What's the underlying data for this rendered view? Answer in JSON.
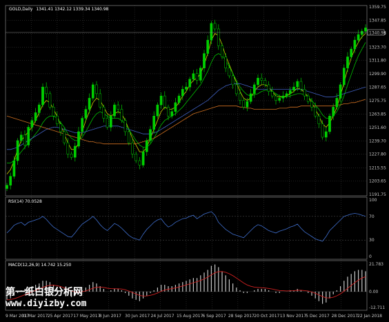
{
  "header": {
    "symbol_label": "GOLD,Daily",
    "ohlc": "1341.41 1342.12 1339.34 1340.98",
    "rsi_label": "RSI(14) 70.0528",
    "macd_label": "MACD(12,26,9) 14.742 15.250"
  },
  "current_price_label": "1340.98",
  "colors": {
    "background": "#000000",
    "candle_up": "#00d000",
    "candle_down": "#000000",
    "candle_outline": "#00d000",
    "ma_short": "#d0d000",
    "ma_mid": "#00c000",
    "ma_long_blue": "#4060c0",
    "ma_long_orange": "#d07020",
    "rsi_line": "#4070d0",
    "macd_hist": "#c8c8c8",
    "macd_signal": "#d02020",
    "grid": "#555555"
  },
  "watermark": {
    "line1": "第一纸白银分析网",
    "line2": "www.diyizby.com"
  },
  "chart_data": [
    {
      "type": "candlestick",
      "title": "GOLD,Daily",
      "price_axis_ticks": [
        "1359.75",
        "1347.85",
        "1335.95",
        "1323.70",
        "1311.80",
        "1299.90",
        "1287.65",
        "1275.75",
        "1263.85",
        "1251.60",
        "1239.70",
        "1227.80",
        "1215.55",
        "1203.65",
        "1191.75"
      ],
      "ylim": [
        1191.75,
        1359.75
      ],
      "date_ticks": [
        "9 Mar 2017",
        "31 Mar 2017",
        "25 Apr 2017",
        "17 May 2017",
        "8 Jun 2017",
        "30 Jun 2017",
        "24 Jul 2017",
        "15 Aug 2017",
        "6 Sep 2017",
        "28 Sep 2017",
        "20 Oct 2017",
        "13 Nov 2017",
        "5 Dec 2017",
        "28 Dec 2017",
        "22 Jan 2018"
      ],
      "close_path": [
        1200,
        1208,
        1222,
        1240,
        1245,
        1236,
        1252,
        1258,
        1265,
        1272,
        1288,
        1282,
        1270,
        1262,
        1255,
        1248,
        1238,
        1228,
        1225,
        1235,
        1248,
        1260,
        1268,
        1278,
        1290,
        1282,
        1270,
        1260,
        1252,
        1262,
        1272,
        1268,
        1258,
        1248,
        1238,
        1228,
        1222,
        1218,
        1230,
        1240,
        1250,
        1262,
        1272,
        1280,
        1270,
        1262,
        1266,
        1274,
        1280,
        1286,
        1288,
        1295,
        1300,
        1294,
        1305,
        1318,
        1330,
        1345,
        1340,
        1325,
        1315,
        1305,
        1298,
        1290,
        1282,
        1276,
        1270,
        1275,
        1282,
        1290,
        1296,
        1294,
        1290,
        1284,
        1280,
        1276,
        1278,
        1280,
        1282,
        1285,
        1288,
        1293,
        1286,
        1280,
        1275,
        1270,
        1262,
        1255,
        1243,
        1248,
        1262,
        1270,
        1278,
        1290,
        1305,
        1315,
        1322,
        1330,
        1335,
        1338,
        1340.98
      ],
      "series": [
        {
          "name": "MA short",
          "values": [
            1210,
            1214,
            1222,
            1232,
            1240,
            1244,
            1248,
            1252,
            1258,
            1265,
            1272,
            1276,
            1274,
            1268,
            1262,
            1254,
            1246,
            1238,
            1232,
            1232,
            1238,
            1248,
            1258,
            1266,
            1274,
            1278,
            1276,
            1270,
            1264,
            1262,
            1264,
            1266,
            1264,
            1258,
            1250,
            1242,
            1236,
            1230,
            1230,
            1234,
            1242,
            1250,
            1258,
            1266,
            1270,
            1268,
            1268,
            1270,
            1274,
            1280,
            1284,
            1290,
            1294,
            1296,
            1300,
            1308,
            1318,
            1330,
            1336,
            1334,
            1326,
            1316,
            1308,
            1300,
            1292,
            1284,
            1278,
            1276,
            1278,
            1284,
            1288,
            1290,
            1290,
            1288,
            1284,
            1280,
            1279,
            1279,
            1280,
            1282,
            1284,
            1287,
            1286,
            1283,
            1279,
            1274,
            1268,
            1262,
            1255,
            1252,
            1256,
            1262,
            1270,
            1280,
            1292,
            1304,
            1314,
            1322,
            1328,
            1333,
            1336
          ]
        },
        {
          "name": "MA mid",
          "values": [
            1220,
            1220,
            1222,
            1226,
            1230,
            1234,
            1238,
            1242,
            1246,
            1250,
            1256,
            1260,
            1262,
            1262,
            1260,
            1256,
            1252,
            1246,
            1242,
            1240,
            1240,
            1243,
            1248,
            1254,
            1260,
            1264,
            1266,
            1264,
            1262,
            1260,
            1260,
            1260,
            1258,
            1255,
            1250,
            1245,
            1240,
            1236,
            1234,
            1234,
            1237,
            1242,
            1248,
            1254,
            1258,
            1260,
            1262,
            1264,
            1267,
            1270,
            1274,
            1278,
            1282,
            1286,
            1290,
            1296,
            1302,
            1310,
            1316,
            1318,
            1316,
            1312,
            1306,
            1300,
            1294,
            1288,
            1284,
            1281,
            1280,
            1281,
            1282,
            1284,
            1285,
            1285,
            1284,
            1282,
            1280,
            1279,
            1279,
            1280,
            1281,
            1282,
            1282,
            1281,
            1279,
            1276,
            1272,
            1268,
            1263,
            1260,
            1260,
            1262,
            1266,
            1272,
            1280,
            1290,
            1299,
            1308,
            1316,
            1322,
            1328
          ]
        },
        {
          "name": "MA long blue",
          "values": [
            1232,
            1232,
            1233,
            1234,
            1236,
            1238,
            1240,
            1242,
            1244,
            1246,
            1248,
            1250,
            1251,
            1252,
            1252,
            1251,
            1250,
            1249,
            1248,
            1247,
            1247,
            1247,
            1248,
            1249,
            1250,
            1251,
            1252,
            1253,
            1253,
            1253,
            1253,
            1253,
            1252,
            1251,
            1250,
            1249,
            1248,
            1247,
            1246,
            1246,
            1246,
            1247,
            1248,
            1250,
            1252,
            1254,
            1256,
            1258,
            1260,
            1262,
            1264,
            1266,
            1268,
            1270,
            1272,
            1274,
            1276,
            1279,
            1282,
            1285,
            1287,
            1289,
            1290,
            1291,
            1291,
            1291,
            1290,
            1289,
            1288,
            1287,
            1286,
            1286,
            1286,
            1286,
            1286,
            1286,
            1286,
            1286,
            1286,
            1286,
            1286,
            1286,
            1286,
            1285,
            1284,
            1283,
            1282,
            1281,
            1280,
            1279,
            1279,
            1279,
            1280,
            1281,
            1282,
            1283,
            1284,
            1285,
            1286,
            1287,
            1288
          ]
        },
        {
          "name": "MA long orange",
          "values": [
            1262,
            1261,
            1260,
            1259,
            1258,
            1257,
            1256,
            1255,
            1254,
            1253,
            1252,
            1251,
            1250,
            1249,
            1248,
            1247,
            1246,
            1245,
            1244,
            1243,
            1242,
            1241,
            1240,
            1239,
            1239,
            1238,
            1238,
            1237,
            1237,
            1237,
            1237,
            1237,
            1237,
            1237,
            1237,
            1237,
            1237,
            1238,
            1239,
            1240,
            1241,
            1242,
            1244,
            1246,
            1248,
            1250,
            1252,
            1254,
            1256,
            1258,
            1260,
            1262,
            1264,
            1265,
            1266,
            1267,
            1268,
            1269,
            1270,
            1271,
            1271,
            1271,
            1271,
            1271,
            1271,
            1270,
            1270,
            1269,
            1269,
            1268,
            1268,
            1268,
            1268,
            1268,
            1268,
            1268,
            1269,
            1269,
            1269,
            1270,
            1270,
            1270,
            1271,
            1271,
            1271,
            1271,
            1271,
            1271,
            1271,
            1271,
            1271,
            1271,
            1272,
            1272,
            1273,
            1273,
            1274,
            1274,
            1275,
            1276,
            1277
          ]
        }
      ]
    },
    {
      "type": "line",
      "title": "RSI(14) 70.0528",
      "ylim": [
        0,
        100
      ],
      "axis_ticks": [
        "100",
        "70",
        "30",
        "0"
      ],
      "values": [
        42,
        48,
        55,
        58,
        60,
        55,
        60,
        62,
        64,
        66,
        70,
        65,
        58,
        52,
        48,
        44,
        40,
        36,
        35,
        42,
        50,
        57,
        61,
        65,
        70,
        64,
        56,
        50,
        46,
        52,
        58,
        55,
        50,
        44,
        38,
        34,
        32,
        30,
        40,
        48,
        54,
        60,
        64,
        66,
        58,
        52,
        55,
        60,
        63,
        66,
        67,
        70,
        72,
        66,
        70,
        74,
        76,
        78,
        72,
        60,
        54,
        48,
        44,
        40,
        38,
        36,
        34,
        40,
        46,
        52,
        56,
        54,
        50,
        46,
        44,
        42,
        45,
        47,
        49,
        52,
        54,
        57,
        50,
        44,
        40,
        36,
        32,
        30,
        28,
        36,
        46,
        52,
        58,
        64,
        70,
        72,
        74,
        75,
        74,
        72,
        70
      ]
    },
    {
      "type": "bar",
      "title": "MACD(12,26,9) 14.742 15.250",
      "ylim": [
        -12.711,
        21.783
      ],
      "axis_ticks": [
        "21.783",
        "0.00",
        "-12.711"
      ],
      "histogram": [
        -6,
        -5,
        -3,
        -1,
        1,
        2,
        3,
        4,
        5,
        6,
        8,
        8,
        7,
        5,
        3,
        1,
        -1,
        -3,
        -4,
        -3,
        -1,
        1,
        3,
        5,
        7,
        6,
        4,
        2,
        0,
        1,
        2,
        2,
        1,
        -1,
        -3,
        -5,
        -6,
        -7,
        -5,
        -3,
        -1,
        1,
        3,
        5,
        5,
        4,
        4,
        5,
        6,
        7,
        8,
        9,
        10,
        10,
        12,
        14,
        16,
        19,
        20,
        18,
        15,
        12,
        9,
        6,
        3,
        1,
        -1,
        -1,
        0,
        1,
        2,
        2,
        2,
        1,
        0,
        -1,
        -1,
        0,
        0,
        1,
        1,
        2,
        1,
        0,
        -1,
        -3,
        -5,
        -7,
        -9,
        -8,
        -5,
        -2,
        1,
        4,
        8,
        11,
        13,
        15,
        16,
        16,
        15
      ]
    }
  ]
}
